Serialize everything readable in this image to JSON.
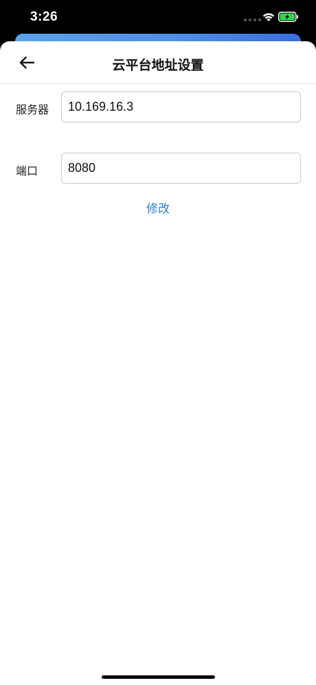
{
  "status_bar": {
    "time": "3:26"
  },
  "header": {
    "title": "云平台地址设置",
    "back_icon": "arrow-left-icon"
  },
  "form": {
    "server": {
      "label": "服务器",
      "value": "10.169.16.3"
    },
    "port": {
      "label": "端口",
      "value": "8080"
    },
    "submit_label": "修改"
  },
  "colors": {
    "accent": "#2b7fd4",
    "battery": "#32d74b",
    "card_gradient_start": "#5aa3ea",
    "card_gradient_end": "#3a6fe0"
  }
}
